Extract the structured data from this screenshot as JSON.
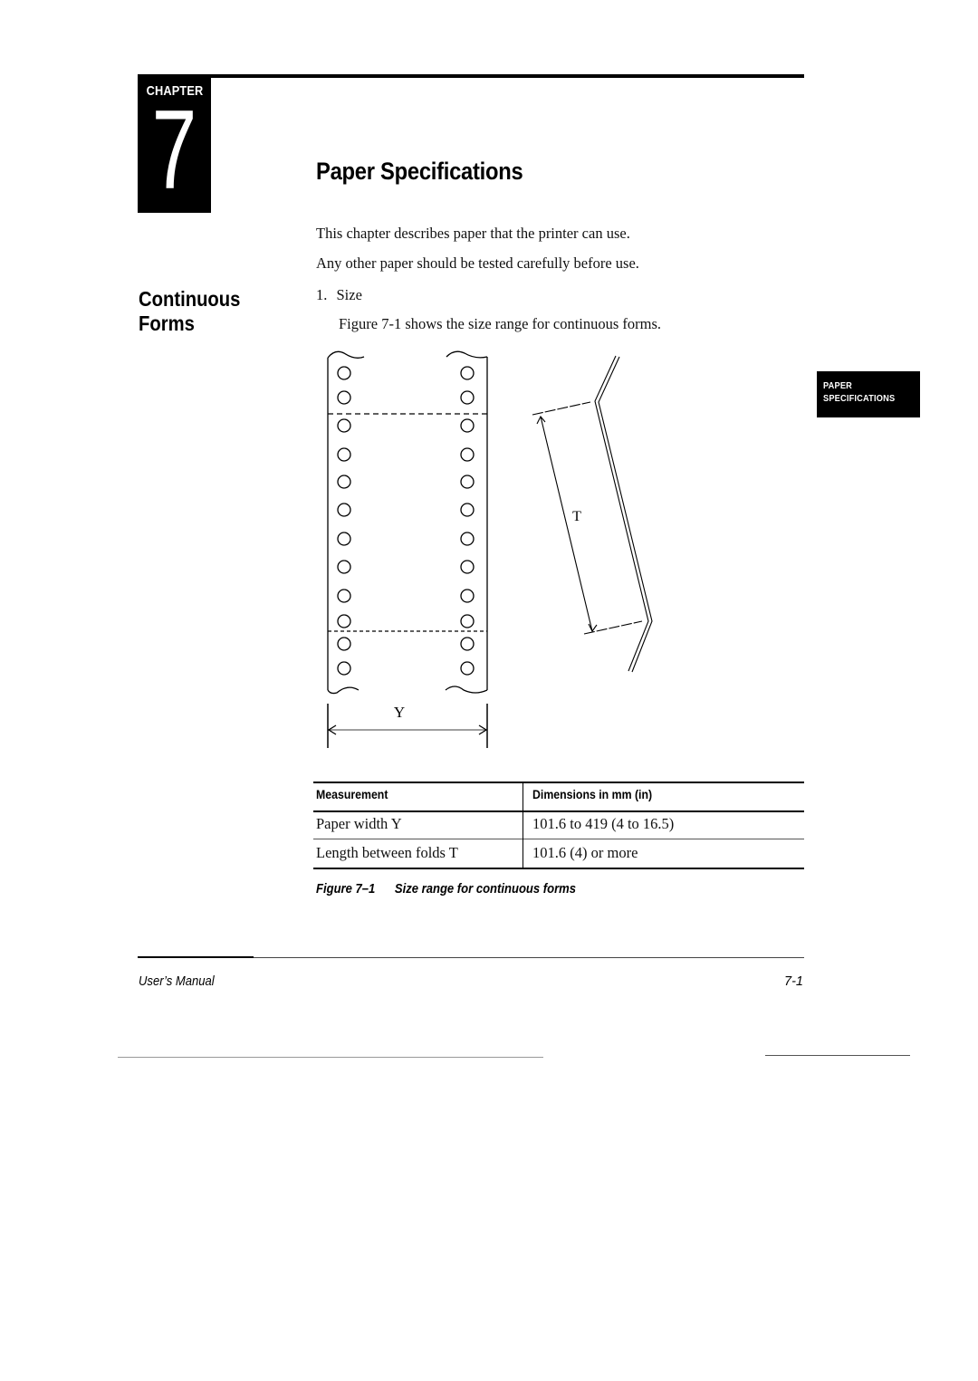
{
  "chapter": {
    "label": "CHAPTER",
    "number": "7"
  },
  "page_title": "Paper Specifications",
  "side_tab": {
    "line1": "PAPER",
    "line2": "SPECIFICATIONS"
  },
  "section_heading": {
    "line1": "Continuous",
    "line2": "Forms"
  },
  "intro": [
    "This chapter describes paper that the printer can use.",
    "Any other paper should be tested carefully before use."
  ],
  "list": [
    {
      "marker": "1.",
      "title": "Size",
      "body": "Figure 7-1 shows the size range for continuous forms."
    }
  ],
  "figure": {
    "label_width": "Y",
    "label_length": "T",
    "icons": {
      "form": "continuous-form-diagram",
      "fold": "fold-profile-diagram"
    }
  },
  "table": {
    "headers": [
      "Measurement",
      "Dimensions in mm (in)"
    ],
    "rows": [
      [
        "Paper width Y",
        "101.6 to 419 (4 to 16.5)"
      ],
      [
        "Length between folds T",
        "101.6 (4) or more"
      ]
    ]
  },
  "caption": {
    "number": "Figure 7–1",
    "text": "Size range for continuous forms"
  },
  "footer": {
    "left": "User’s Manual",
    "right": "7-1"
  }
}
